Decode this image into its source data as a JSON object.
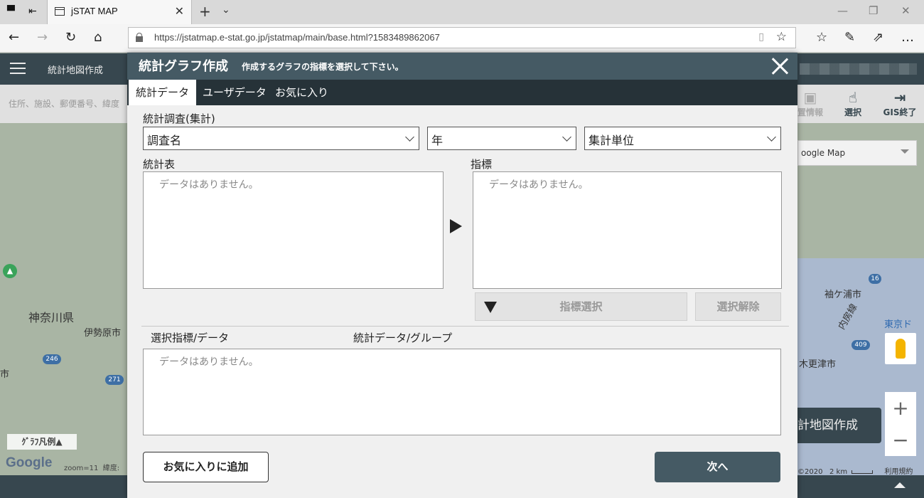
{
  "browser": {
    "tab_title": "jSTAT MAP",
    "url": "https://jstatmap.e-stat.go.jp/jstatmap/main/base.html?1583489862067"
  },
  "app": {
    "menu_title": "統計地図作成",
    "search_placeholder": "住所、施設、郵便番号、緯度",
    "tools": [
      {
        "label": "置情報",
        "icon": "location-icon"
      },
      {
        "label": "選択",
        "icon": "hand-pointer-icon"
      },
      {
        "label": "GIS終了",
        "icon": "exit-icon"
      }
    ]
  },
  "map": {
    "type_selector": "oogle Map",
    "labels": {
      "kanagawa": "神奈川県",
      "isehara": "伊勢原市",
      "city_left": "市",
      "sodegaura": "袖ケ浦市",
      "tokyo": "東京ド",
      "kisarazu": "木更津市",
      "uchibo": "内房線"
    },
    "road_badges": [
      "246",
      "271",
      "16",
      "409"
    ],
    "legend_button": "ｸﾞﾗﾌ凡例▲",
    "google": "Google",
    "zoom": "zoom=11",
    "latlng": "緯度:",
    "create_button": "計地図作成",
    "copyright": "©2020",
    "scale": "2 km",
    "terms": "利用規約"
  },
  "modal": {
    "title": "統計グラフ作成",
    "subtitle": "作成するグラフの指標を選択して下さい。",
    "tabs": [
      "統計データ",
      "ユーザデータ",
      "お気に入り"
    ],
    "survey_label": "統計調査(集計)",
    "selects": {
      "survey_name": "調査名",
      "year": "年",
      "unit": "集計単位"
    },
    "table_label": "統計表",
    "indicator_label": "指標",
    "empty_text": "データはありません。",
    "indicator_select_button": "指標選択",
    "deselect_button": "選択解除",
    "selected_header_1": "選択指標/データ",
    "selected_header_2": "統計データ/グループ",
    "add_favorite_button": "お気に入りに追加",
    "next_button": "次へ"
  },
  "colors": {
    "header": "#37474f",
    "modal_header": "#455a64",
    "tab_bar": "#263238"
  }
}
